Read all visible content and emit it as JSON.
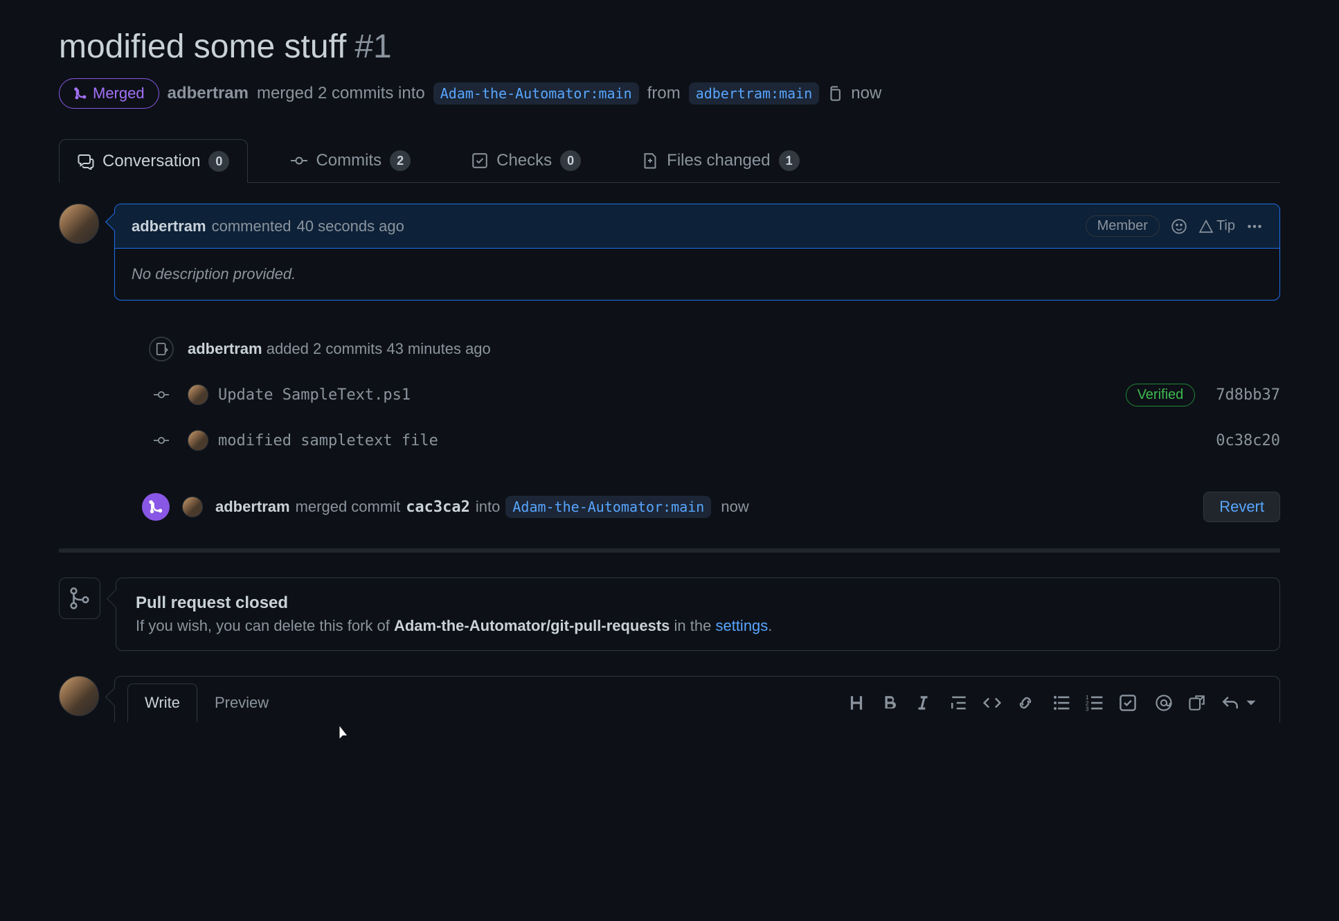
{
  "header": {
    "title": "modified some stuff",
    "number": "#1",
    "status": "Merged",
    "author": "adbertram",
    "merge_summary_pre": " merged 2 commits into ",
    "target_branch": "Adam-the-Automator:main",
    "merge_summary_mid": " from ",
    "source_branch": "adbertram:main",
    "when": "now"
  },
  "tabs": {
    "conversation": {
      "label": "Conversation",
      "count": "0"
    },
    "commits": {
      "label": "Commits",
      "count": "2"
    },
    "checks": {
      "label": "Checks",
      "count": "0"
    },
    "files": {
      "label": "Files changed",
      "count": "1"
    }
  },
  "comment": {
    "author": "adbertram",
    "verb": "commented",
    "time": "40 seconds ago",
    "role": "Member",
    "tip_label": "Tip",
    "body": "No description provided."
  },
  "push_event": {
    "author": "adbertram",
    "text": " added 2 commits ",
    "time": "43 minutes ago"
  },
  "commits": [
    {
      "message": "Update SampleText.ps1",
      "verified": "Verified",
      "sha": "7d8bb37"
    },
    {
      "message": "modified sampletext file",
      "verified": "",
      "sha": "0c38c20"
    }
  ],
  "merge_event": {
    "author": "adbertram",
    "text_pre": " merged commit ",
    "sha": "cac3ca2",
    "text_mid": " into ",
    "branch": "Adam-the-Automator:main",
    "when": "now",
    "revert_label": "Revert"
  },
  "closed_box": {
    "title": "Pull request closed",
    "desc_pre": "If you wish, you can delete this fork of ",
    "repo": "Adam-the-Automator/git-pull-requests",
    "desc_mid": " in the ",
    "link": "settings",
    "desc_post": "."
  },
  "editor": {
    "write": "Write",
    "preview": "Preview"
  }
}
